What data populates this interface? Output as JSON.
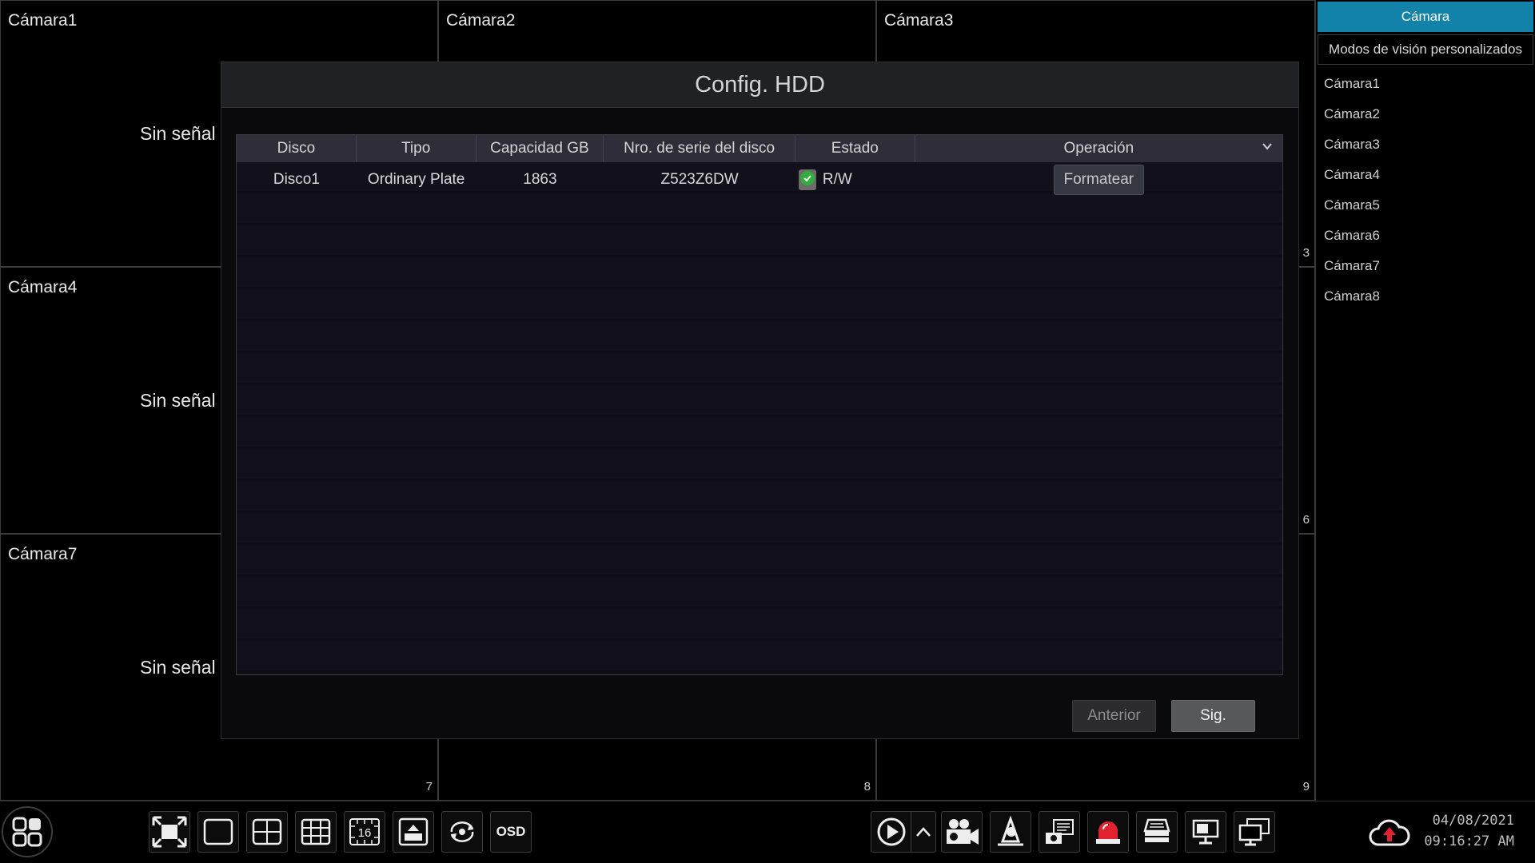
{
  "cameras": [
    {
      "name": "Cámara1",
      "no_signal": "Sin señal"
    },
    {
      "name": "Cámara2"
    },
    {
      "name": "Cámara3"
    },
    {
      "name": "Cámara4",
      "no_signal": "Sin señal"
    },
    {
      "name": "Cámara7",
      "no_signal": "Sin señal"
    }
  ],
  "cell_numbers": {
    "n3": "3",
    "n6": "6",
    "n7": "7",
    "n8": "8",
    "n9": "9"
  },
  "side_panel": {
    "tab_camera": "Cámara",
    "tab_custom_views": "Modos de visión personalizados",
    "items": [
      "Cámara1",
      "Cámara2",
      "Cámara3",
      "Cámara4",
      "Cámara5",
      "Cámara6",
      "Cámara7",
      "Cámara8"
    ]
  },
  "dialog": {
    "title": "Config. HDD",
    "columns": [
      "Disco",
      "Tipo",
      "Capacidad GB",
      "Nro. de serie del disco",
      "Estado",
      "Operación"
    ],
    "rows": [
      {
        "disk": "Disco1",
        "type": "Ordinary Plate",
        "capacity": "1863",
        "serial": "Z523Z6DW",
        "status": "R/W",
        "operation": "Formatear"
      }
    ],
    "prev_label": "Anterior",
    "next_label": "Sig."
  },
  "toolbar": {
    "osd_label": "OSD",
    "layout_16_label": "16",
    "date": "04/08/2021",
    "time": "09:16:27 AM"
  },
  "colors": {
    "accent": "#1282a8",
    "status_ok": "#2fae3c",
    "alarm": "#e0232e"
  }
}
